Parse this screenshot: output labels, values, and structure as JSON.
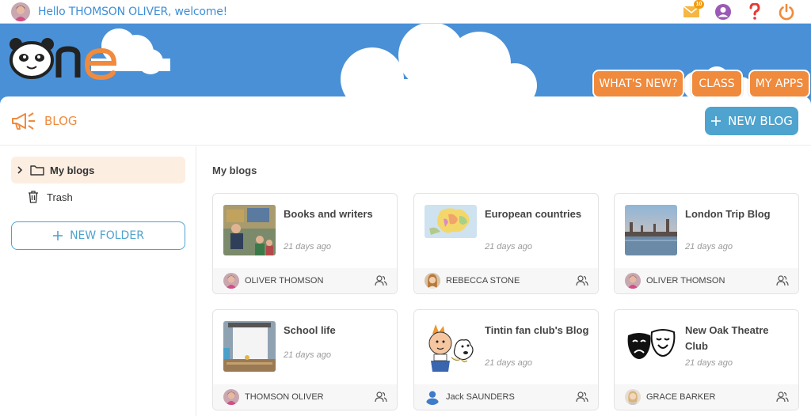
{
  "topbar": {
    "greeting": "Hello THOMSON OLIVER, welcome!",
    "mail_count": "10",
    "icons": [
      "mail-icon",
      "profile-icon",
      "help-icon",
      "power-icon"
    ]
  },
  "nav": {
    "whats_new": "WHAT'S NEW?",
    "class": "CLASS",
    "my_apps": "MY APPS"
  },
  "page": {
    "title": "BLOG",
    "new_blog": "NEW BLOG"
  },
  "sidebar": {
    "items": [
      {
        "label": "My blogs",
        "icon": "folder-icon",
        "active": true
      },
      {
        "label": "Trash",
        "icon": "trash-icon",
        "active": false
      }
    ],
    "new_folder": "NEW FOLDER"
  },
  "main": {
    "section_title": "My blogs",
    "blogs": [
      {
        "title": "Books and writers",
        "date": "21 days ago",
        "author": "OLIVER THOMSON"
      },
      {
        "title": "European countries",
        "date": "21 days ago",
        "author": "REBECCA STONE"
      },
      {
        "title": "London Trip Blog",
        "date": "21 days ago",
        "author": "OLIVER THOMSON"
      },
      {
        "title": "School life",
        "date": "21 days ago",
        "author": "THOMSON OLIVER"
      },
      {
        "title": "Tintin fan club's Blog",
        "date": "21 days ago",
        "author": "Jack SAUNDERS"
      },
      {
        "title": "New Oak Theatre Club",
        "date": "21 days ago",
        "author": "GRACE BARKER"
      }
    ]
  },
  "colors": {
    "sky": "#4a90d6",
    "orange": "#f08a3c",
    "blue_button": "#4ea3cf",
    "active_bg": "#fdeee2"
  }
}
